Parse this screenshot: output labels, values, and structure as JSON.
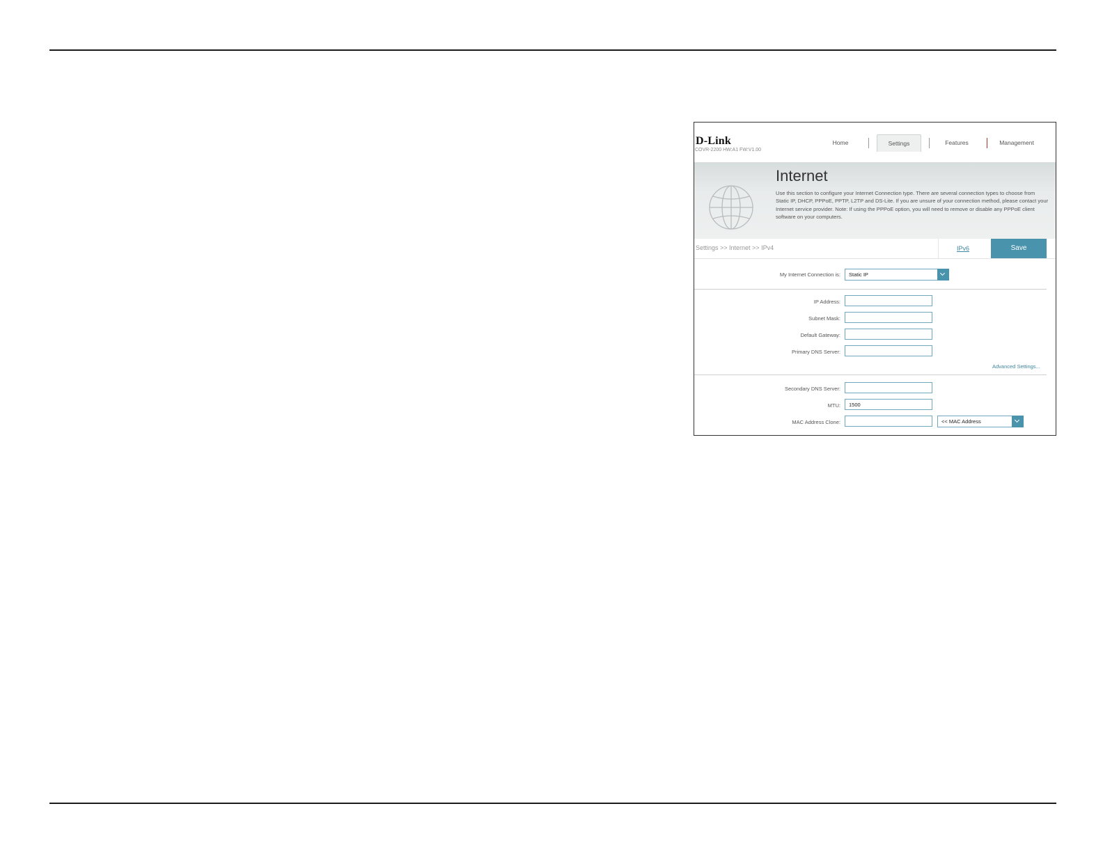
{
  "router": {
    "brand": "D-Link",
    "model_info": "COVR-2200 HW:A1 FW:V1.00",
    "nav": {
      "home": "Home",
      "settings": "Settings",
      "features": "Features",
      "management": "Management"
    },
    "page_title": "Internet",
    "page_description": "Use this section to configure your Internet Connection type. There are several connection types to choose from Static IP, DHCP, PPPoE, PPTP, L2TP and DS-Lite. If you are unsure of your connection method, please contact your Internet service provider. Note: If using the PPPoE option, you will need to remove or disable any PPPoE client software on your computers.",
    "breadcrumb": "Settings >> Internet >> IPv4",
    "ipv6_link": "IPv6",
    "save_label": "Save",
    "form": {
      "connection_label": "My Internet Connection is:",
      "connection_value": "Static IP",
      "ip_address_label": "IP Address:",
      "ip_address_value": "",
      "subnet_mask_label": "Subnet Mask:",
      "subnet_mask_value": "",
      "default_gateway_label": "Default Gateway:",
      "default_gateway_value": "",
      "primary_dns_label": "Primary DNS Server:",
      "primary_dns_value": "",
      "advanced_link": "Advanced Settings...",
      "secondary_dns_label": "Secondary DNS Server:",
      "secondary_dns_value": "",
      "mtu_label": "MTU:",
      "mtu_value": "1500",
      "mac_clone_label": "MAC Address Clone:",
      "mac_clone_value": "",
      "mac_select_value": "<< MAC Address"
    }
  },
  "colors": {
    "accent": "#4a93ad",
    "nav_separator": "#b3332b"
  },
  "icons": {
    "globe": "globe-icon",
    "dropdown": "chevron-down-icon"
  }
}
